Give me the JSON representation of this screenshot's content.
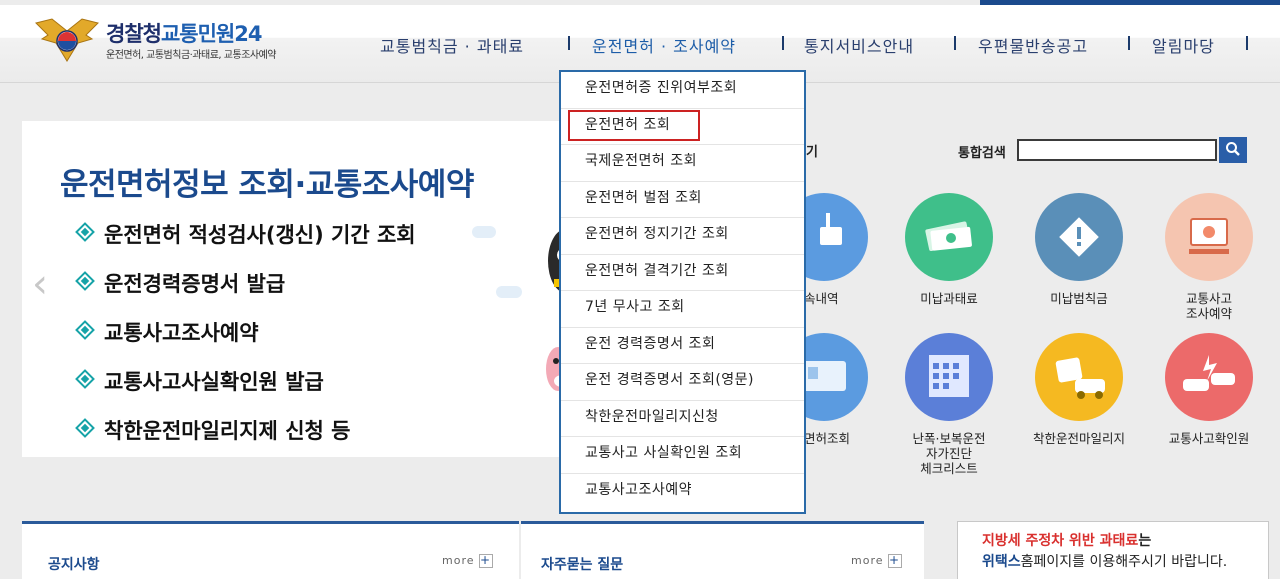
{
  "header": {
    "logo_main": "경찰청",
    "logo_accent": "교통민원24",
    "logo_sub": "운전면허, 교통범칙금·과태료, 교통조사예약"
  },
  "gnb": [
    {
      "label": "교통범칙금 · 과태료"
    },
    {
      "label": "운전면허 · 조사예약"
    },
    {
      "label": "통지서비스안내"
    },
    {
      "label": "우편물반송공고"
    },
    {
      "label": "알림마당"
    }
  ],
  "dropdown": [
    {
      "label": "운전면허증 진위여부조회"
    },
    {
      "label": "운전면허 조회"
    },
    {
      "label": "국제운전면허 조회"
    },
    {
      "label": "운전면허 벌점 조회"
    },
    {
      "label": "운전면허 정지기간 조회"
    },
    {
      "label": "운전면허 결격기간 조회"
    },
    {
      "label": "7년 무사고 조회"
    },
    {
      "label": "운전 경력증명서 조회"
    },
    {
      "label": "운전 경력증명서 조회(영문)"
    },
    {
      "label": "착한운전마일리지신청"
    },
    {
      "label": "교통사고 사실확인원 조회"
    },
    {
      "label": "교통사고조사예약"
    }
  ],
  "banner": {
    "title": "운전면허정보 조회·교통조사예약",
    "items": [
      "운전면허 적성검사(갱신) 기간 조회",
      "운전경력증명서 발급",
      "교통사고조사예약",
      "교통사고사실확인원 발급",
      "착한운전마일리지제 신청 등"
    ],
    "prev_arrow": "‹"
  },
  "search": {
    "tab_fragment": "기",
    "label": "통합검색",
    "value": ""
  },
  "services": {
    "row1": [
      {
        "label": "속내역",
        "color": "#5b9be0"
      },
      {
        "label": "미납과태료",
        "color": "#3fbf8a"
      },
      {
        "label": "미납범칙금",
        "color": "#5a8fb8"
      },
      {
        "label": "교통사고\n조사예약",
        "color": "#f28a6a"
      }
    ],
    "row2": [
      {
        "label": "면허조회",
        "color": "#5b9be0"
      },
      {
        "label": "난폭·보복운전\n자가진단\n체크리스트",
        "color": "#5b7fd8"
      },
      {
        "label": "착한운전마일리지",
        "color": "#f5b921"
      },
      {
        "label": "교통사고확인원",
        "color": "#ec6a6a"
      }
    ]
  },
  "panels": {
    "notice_title": "공지사항",
    "faq_title": "자주묻는 질문",
    "more": "more",
    "plus": "+"
  },
  "notice_box": {
    "line1_red": "지방세 주정차 위반 과태료",
    "line1_rest": "는",
    "line2_bold": "위택스",
    "line2_rest": "홈페이지를 이용해주시기 바랍니다."
  }
}
